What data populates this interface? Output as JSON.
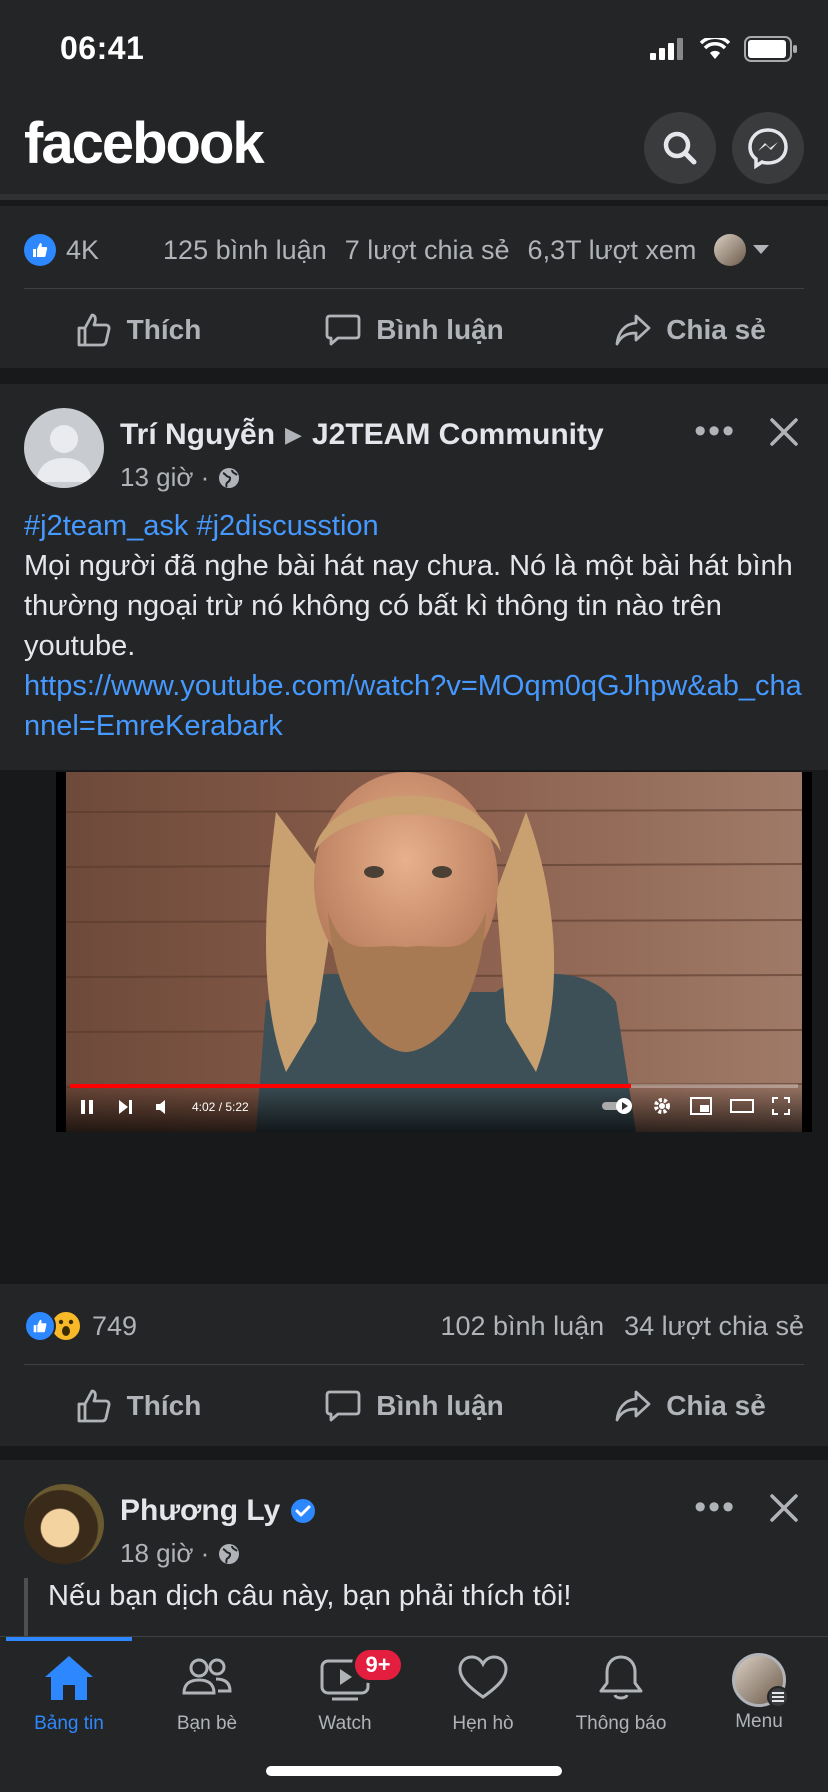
{
  "status": {
    "time": "06:41"
  },
  "header": {
    "logo": "facebook"
  },
  "prev_post": {
    "likes": "4K",
    "comments": "125 bình luận",
    "shares": "7 lượt chia sẻ",
    "views": "6,3T lượt xem"
  },
  "actions": {
    "like": "Thích",
    "comment": "Bình luận",
    "share": "Chia sẻ"
  },
  "post1": {
    "author": "Trí Nguyễn",
    "arrow": "▶",
    "group": "J2TEAM Community",
    "time": "13 giờ ·",
    "hashtags": "#j2team_ask #j2discusstion",
    "body": "Mọi người đã nghe bài hát nay chưa. Nó là một bài hát bình thường ngoại trừ nó không có bất kì thông tin nào trên youtube.",
    "link": "https://www.youtube.com/watch?v=MOqm0qGJhpw&ab_channel=EmreKerabark",
    "video_time": "4:02 / 5:22",
    "video_progress": 0.77,
    "reactions": "749",
    "comments": "102 bình luận",
    "shares": "34 lượt chia sẻ"
  },
  "post2": {
    "author": "Phương Ly",
    "time": "18 giờ ·",
    "body": "Nếu bạn dịch câu này, bạn phải thích tôi!"
  },
  "tabs": [
    {
      "label": "Bảng tin",
      "icon": "home-icon"
    },
    {
      "label": "Bạn bè",
      "icon": "friends-icon"
    },
    {
      "label": "Watch",
      "icon": "watch-icon",
      "badge": "9+"
    },
    {
      "label": "Hẹn hò",
      "icon": "heart-icon"
    },
    {
      "label": "Thông báo",
      "icon": "bell-icon"
    },
    {
      "label": "Menu",
      "icon": "avatar-icon"
    }
  ],
  "colors": {
    "accent": "#2d88ff",
    "link": "#4599ff",
    "badge": "#e41e3f",
    "card": "#242526",
    "background": "#18191a"
  }
}
